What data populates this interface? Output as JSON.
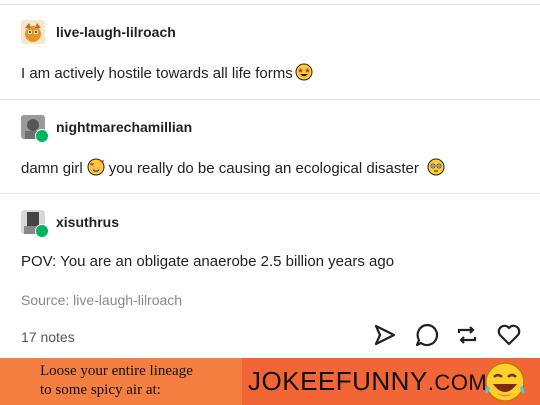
{
  "posts": [
    {
      "username": "live-laugh-lilroach",
      "text": "I am actively hostile towards all life forms",
      "emoji": "star-struck-emoji"
    },
    {
      "username": "nightmarechamillian",
      "text_before": "damn girl",
      "emoji_mid": "smiling-hearts-emoji",
      "text_after": "you really do be causing an ecological disaster",
      "emoji_end": "flushed-emoji",
      "reblogged": true
    },
    {
      "username": "xisuthrus",
      "text": "POV: You are an obligate anaerobe 2.5 billion years ago",
      "reblogged": true
    }
  ],
  "source": "Source: live-laugh-lilroach",
  "notes": "17 notes",
  "actions": [
    "share-icon",
    "reply-icon",
    "reblog-icon",
    "like-icon"
  ],
  "banner": {
    "line1": "Loose your entire lineage",
    "line2": "to some spicy air at:",
    "brand_main": "JOKEEFUNNY",
    "brand_suffix": ".COM",
    "logo": "laughing-emoji-logo"
  },
  "colors": {
    "reblog_badge": "#00b35f",
    "banner_bg": "#f26535",
    "banner_left": "#f47f40"
  }
}
